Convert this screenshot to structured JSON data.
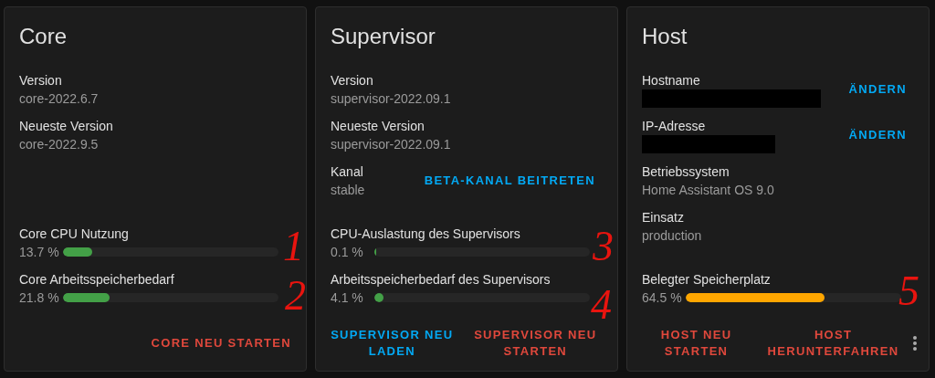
{
  "cards": [
    {
      "title": "Core",
      "rows": [
        {
          "label": "Version",
          "value": "core-2022.6.7"
        },
        {
          "label": "Neueste Version",
          "value": "core-2022.9.5"
        }
      ],
      "meters": [
        {
          "label": "Core CPU Nutzung",
          "reading": "13.7 %",
          "level": 0.137,
          "color": "#43a047"
        },
        {
          "label": "Core Arbeitsspeicherbedarf",
          "reading": "21.8 %",
          "level": 0.218,
          "color": "#43a047"
        }
      ],
      "actions": [
        {
          "label": "CORE NEU STARTEN",
          "kind": "danger"
        }
      ],
      "marks": [
        "1",
        "2"
      ]
    },
    {
      "title": "Supervisor",
      "rows": [
        {
          "label": "Version",
          "value": "supervisor-2022.09.1"
        },
        {
          "label": "Neueste Version",
          "value": "supervisor-2022.09.1"
        },
        {
          "label": "Kanal",
          "value": "stable",
          "action": "BETA-KANAL BEITRETEN"
        }
      ],
      "meters": [
        {
          "label": "CPU-Auslastung des Supervisors",
          "reading": "0.1 %",
          "level": 0.001,
          "color": "#43a047"
        },
        {
          "label": "Arbeitsspeicherbedarf des Supervisors",
          "reading": "4.1 %",
          "level": 0.041,
          "color": "#43a047"
        }
      ],
      "actions": [
        {
          "label": "SUPERVISOR NEU LADEN",
          "kind": "primary"
        },
        {
          "label": "SUPERVISOR NEU STARTEN",
          "kind": "danger"
        }
      ],
      "marks": [
        "3",
        "4"
      ]
    },
    {
      "title": "Host",
      "rows": [
        {
          "label": "Hostname",
          "redacted": true,
          "action": "ÄNDERN"
        },
        {
          "label": "IP-Adresse",
          "redacted": true,
          "action": "ÄNDERN"
        },
        {
          "label": "Betriebssystem",
          "value": "Home Assistant OS 9.0"
        },
        {
          "label": "Einsatz",
          "value": "production"
        }
      ],
      "meters": [
        {
          "label": "Belegter Speicherplatz",
          "reading": "64.5 %",
          "level": 0.645,
          "color": "#ffa600"
        }
      ],
      "actions": [
        {
          "label": "HOST NEU STARTEN",
          "kind": "danger"
        },
        {
          "label": "HOST HERUNTERFAHREN",
          "kind": "danger"
        }
      ],
      "menu": true,
      "marks": [
        "5"
      ]
    }
  ]
}
